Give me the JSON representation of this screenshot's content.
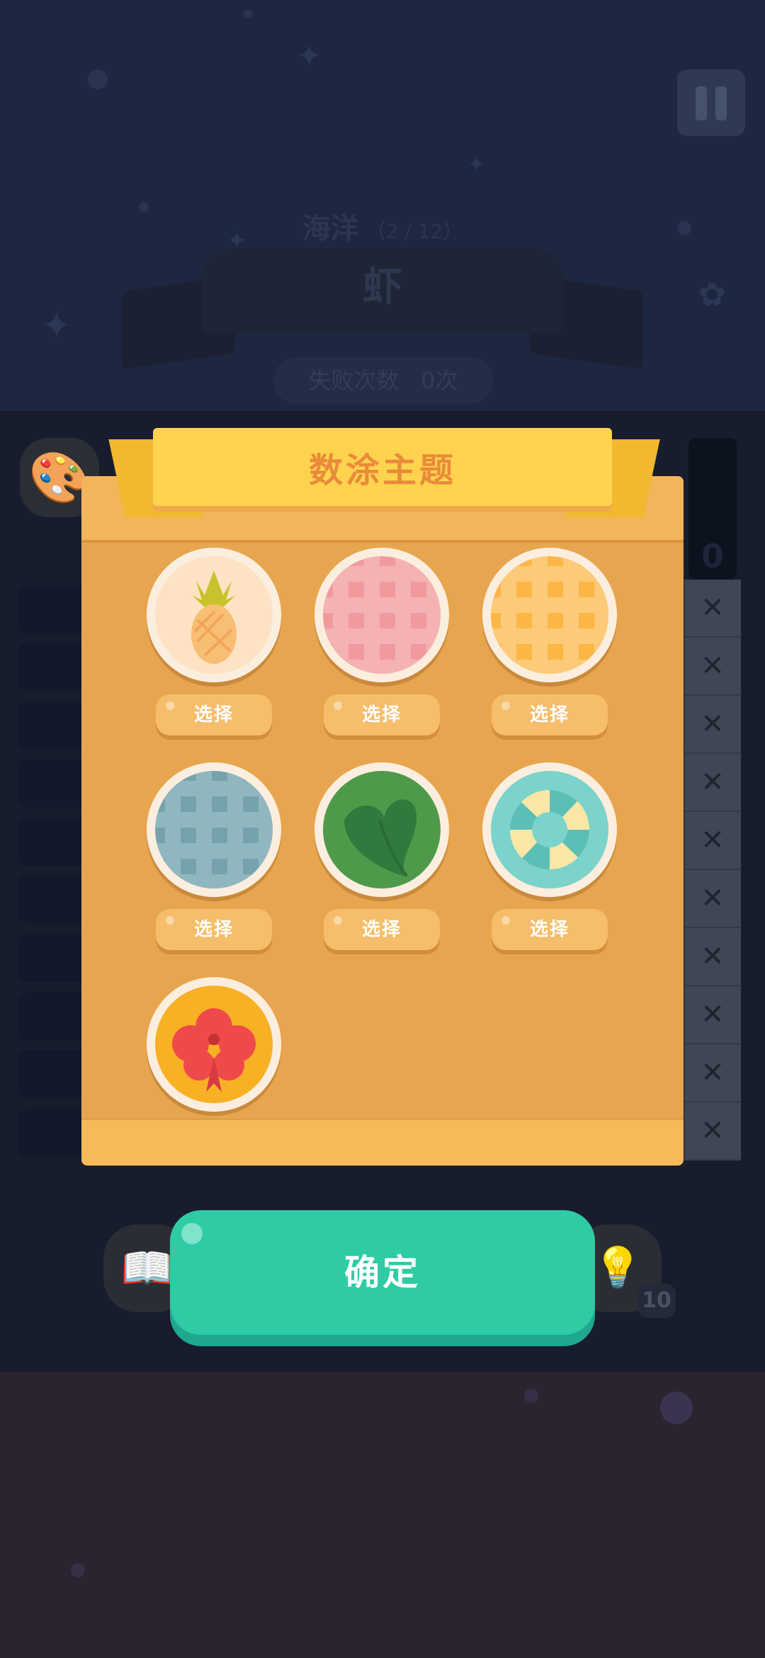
{
  "header": {
    "level_name": "海洋",
    "progress": "（2 / 12）",
    "word": "虾",
    "fail_label": "失败次数",
    "fail_count": "0次"
  },
  "grid": {
    "column_value": "0",
    "x_mark": "✕"
  },
  "dialog": {
    "title": "数涂主题",
    "themes": [
      {
        "name": "pineapple",
        "select_label": "选择"
      },
      {
        "name": "pink-plaid",
        "select_label": "选择"
      },
      {
        "name": "orange-plaid",
        "select_label": "选择"
      },
      {
        "name": "blue-plaid",
        "select_label": "选择"
      },
      {
        "name": "green-leaf",
        "select_label": "选择"
      },
      {
        "name": "teal-lifebuoy",
        "select_label": "选择"
      },
      {
        "name": "hibiscus",
        "select_label": ""
      }
    ],
    "confirm_label": "确定"
  },
  "toolbar": {
    "hint_count": "10",
    "book_icon": "book-icon",
    "hint_icon": "lightbulb-icon"
  },
  "colors": {
    "panel": "#e8a54f",
    "banner": "#ffd34d",
    "banner_text": "#e98b3b",
    "confirm": "#2ecba4"
  }
}
